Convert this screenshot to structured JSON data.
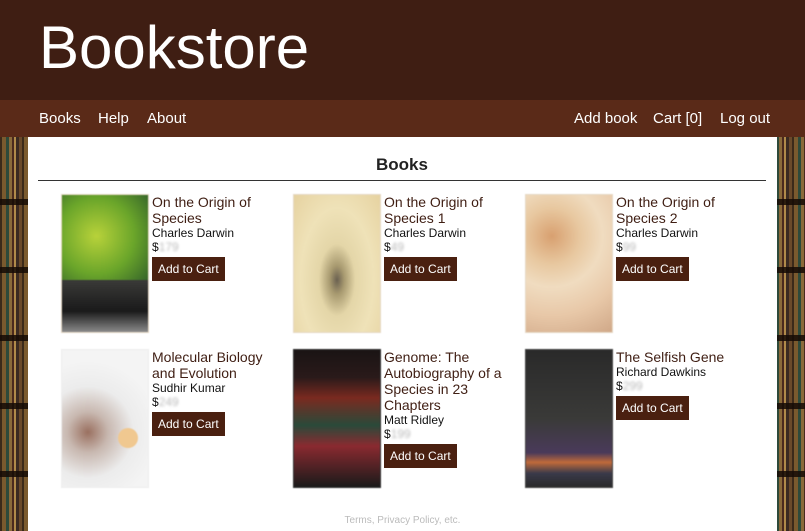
{
  "header": {
    "title": "Bookstore"
  },
  "nav": {
    "left": [
      "Books",
      "Help",
      "About"
    ],
    "right": [
      "Add book",
      "Cart [0]",
      "Log out"
    ]
  },
  "main": {
    "section_title": "Books",
    "books": [
      {
        "title": "On the Origin of Species",
        "author": "Charles Darwin",
        "currency": "$",
        "price": "179",
        "button": "Add to Cart"
      },
      {
        "title": "On the Origin of Species 1",
        "author": "Charles Darwin",
        "currency": "$",
        "price": "49",
        "button": "Add to Cart"
      },
      {
        "title": "On the Origin of Species 2",
        "author": "Charles Darwin",
        "currency": "$",
        "price": "99",
        "button": "Add to Cart"
      },
      {
        "title": "Molecular Biology and Evolution",
        "author": "Sudhir Kumar",
        "currency": "$",
        "price": "249",
        "button": "Add to Cart"
      },
      {
        "title": "Genome: The Autobiography of a Species in 23 Chapters",
        "author": "Matt Ridley",
        "currency": "$",
        "price": "199",
        "button": "Add to Cart"
      },
      {
        "title": "The Selfish Gene",
        "author": "Richard Dawkins",
        "currency": "$",
        "price": "299",
        "button": "Add to Cart"
      }
    ]
  },
  "footer": {
    "text": "Terms, Privacy Policy, etc."
  }
}
